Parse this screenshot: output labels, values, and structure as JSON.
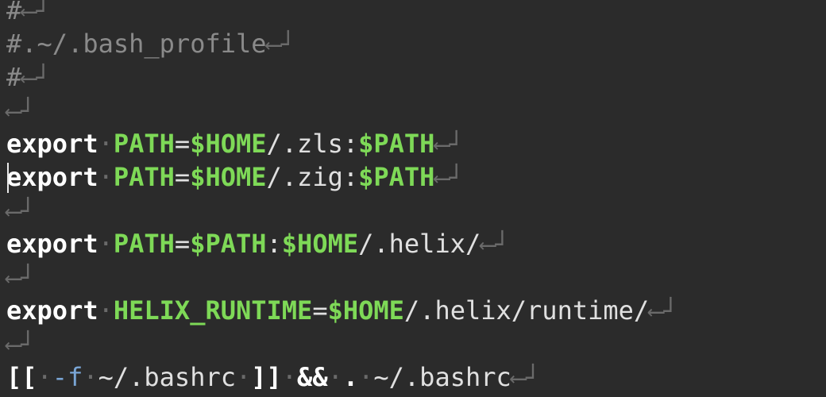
{
  "editor": {
    "newline_glyph": "⟵┘",
    "whitespace_glyph": "·",
    "lines": {
      "l1": {
        "comment": "#"
      },
      "l2": {
        "comment": "#.~/.bash_profile"
      },
      "l3": {
        "comment": "#"
      },
      "l5": {
        "kw": "export",
        "var": "PATH",
        "eq": "=",
        "home": "$HOME",
        "rest": "/.zls:",
        "path": "$PATH"
      },
      "l6": {
        "kw": "export",
        "var": "PATH",
        "eq": "=",
        "home": "$HOME",
        "rest": "/.zig:",
        "path": "$PATH"
      },
      "l8": {
        "kw": "export",
        "var": "PATH",
        "eq": "=",
        "path": "$PATH",
        "colon": ":",
        "home": "$HOME",
        "rest": "/.helix/"
      },
      "l10": {
        "kw": "export",
        "var": "HELIX_RUNTIME",
        "eq": "=",
        "home": "$HOME",
        "rest": "/.helix/runtime/"
      },
      "l12": {
        "open": "[[",
        "flag": "-f",
        "file1": "~/.bashrc",
        "close": "]]",
        "and": "&&",
        "dot": ".",
        "file2": "~/.bashrc"
      }
    }
  },
  "colors": {
    "background": "#2b2b2b",
    "keyword": "#ffffff",
    "variable": "#7ed957",
    "comment": "#8a8a8a",
    "flag": "#7aa6d6"
  }
}
